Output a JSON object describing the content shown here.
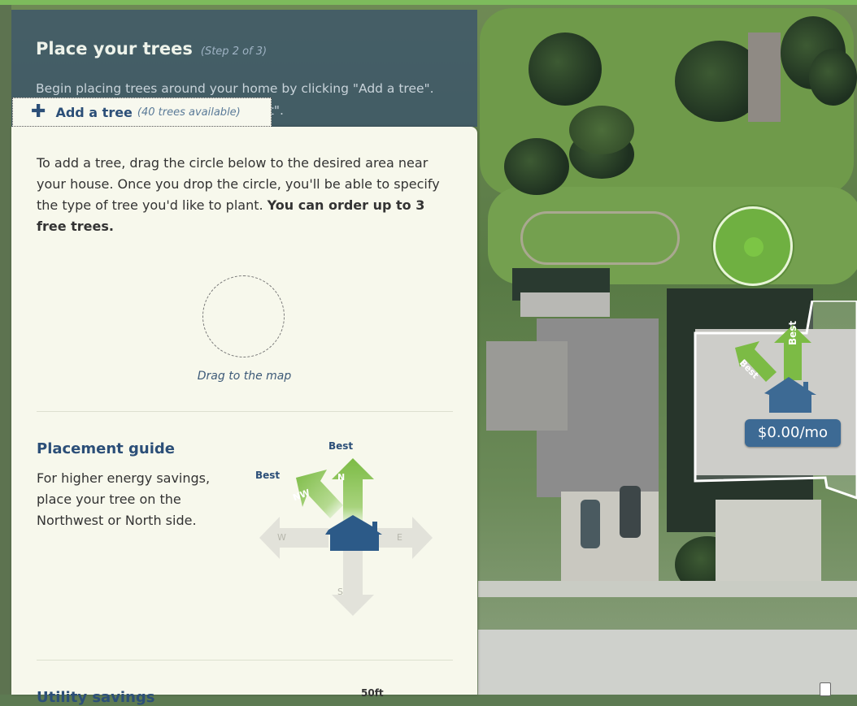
{
  "panel": {
    "title": "Place your trees",
    "step": "(Step 2 of 3)",
    "description": "Begin placing trees around your home by clicking \"Add a tree\". When you're finished, click \"Checkout\".",
    "add_tree": {
      "label": "Add a tree",
      "available": "(40 trees available)"
    },
    "instructions_plain": "To add a tree, drag the circle below to the desired area near your house. Once you drop the circle, you'll be able to specify the type of tree you'd like to plant.",
    "instructions_bold": "You can order up to 3 free trees.",
    "drag_label": "Drag to the map",
    "guide": {
      "title": "Placement guide",
      "text": "For higher energy savings, place your tree on the Northwest or North side.",
      "compass": {
        "best_n": "Best",
        "best_nw": "Best",
        "n": "N",
        "nw": "NW",
        "w": "W",
        "e": "E",
        "s": "S"
      }
    },
    "next_section_title": "Utility savings",
    "next_section_mark": "50ft"
  },
  "map": {
    "price": "$0.00/mo",
    "house_badges": {
      "best_north": "Best",
      "best_nw": "Best"
    }
  },
  "colors": {
    "accent_blue": "#2c4f78",
    "house_blue": "#3d6a94",
    "best_green": "#7cbb45",
    "panel_bg": "#f7f8ec"
  }
}
